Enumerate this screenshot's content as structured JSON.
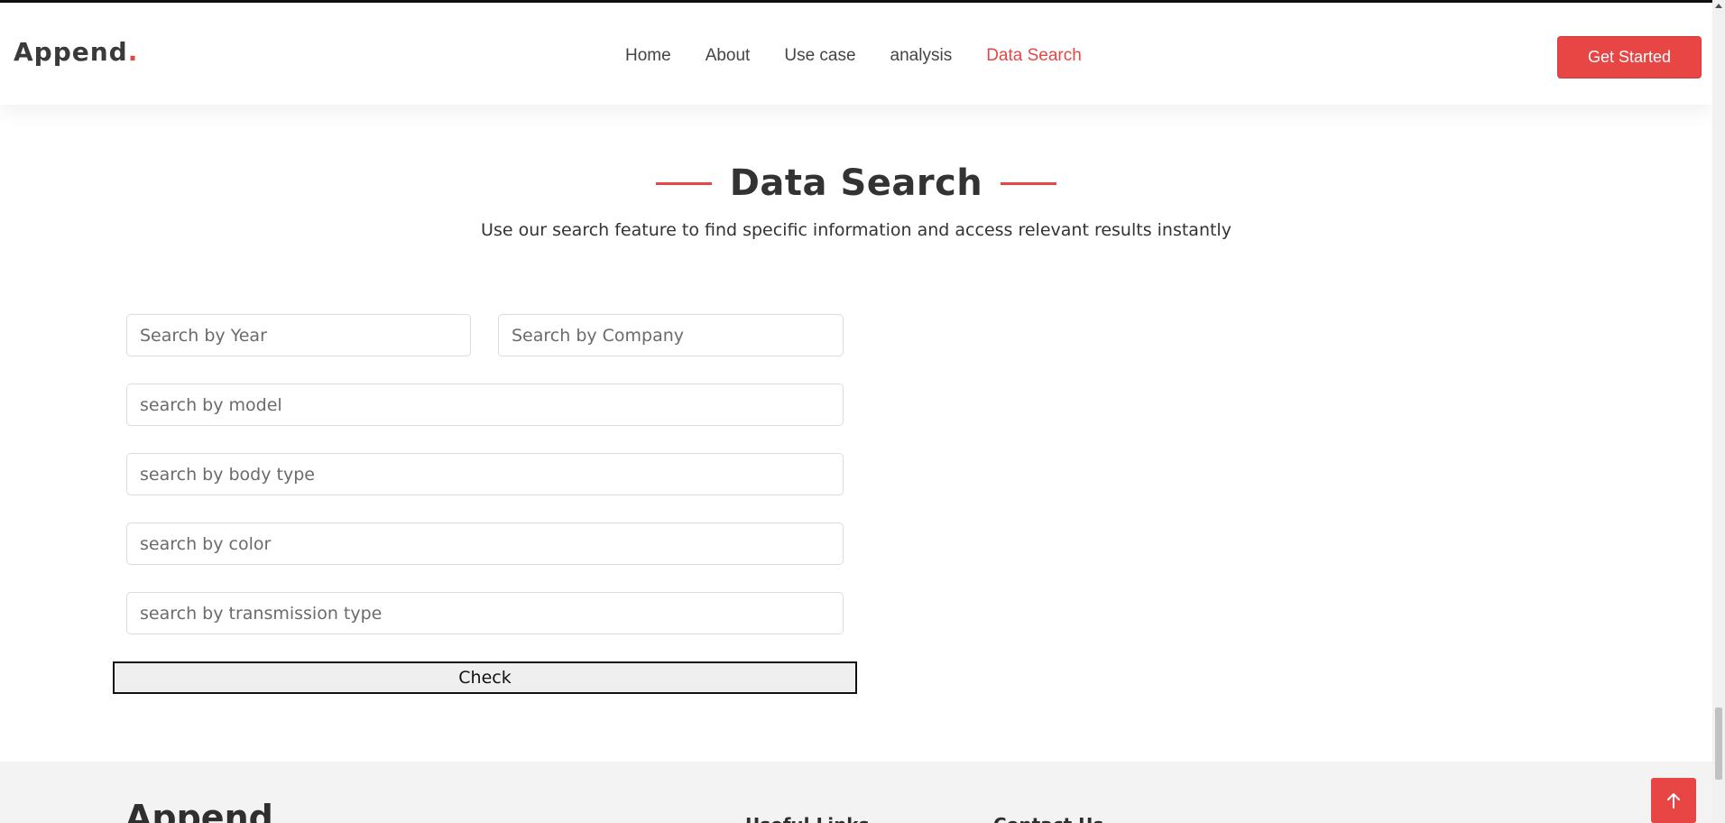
{
  "header": {
    "logo_text": "Append",
    "logo_dot": ".",
    "nav": [
      {
        "label": "Home"
      },
      {
        "label": "About"
      },
      {
        "label": "Use case"
      },
      {
        "label": "analysis"
      },
      {
        "label": "Data Search"
      }
    ],
    "active_nav": "Data Search",
    "cta_label": "Get Started"
  },
  "section": {
    "title": "Data Search",
    "subtitle": "Use our search feature to find specific information and access relevant results instantly"
  },
  "form": {
    "year_placeholder": "Search by Year",
    "company_placeholder": "Search by Company",
    "model_placeholder": "search by model",
    "body_type_placeholder": "search by body type",
    "color_placeholder": "search by color",
    "transmission_placeholder": "search by transmission type",
    "year_value": "",
    "company_value": "",
    "model_value": "",
    "body_type_value": "",
    "color_value": "",
    "transmission_value": "",
    "submit_label": "Check"
  },
  "footer": {
    "logo_text": "Append",
    "useful_links_heading": "Useful Links",
    "contact_heading": "Contact Us"
  },
  "colors": {
    "accent": "#e84545",
    "text": "#333333",
    "footer_bg": "#f3f3f3"
  },
  "icons": {
    "back_to_top": "arrow-up-icon"
  }
}
